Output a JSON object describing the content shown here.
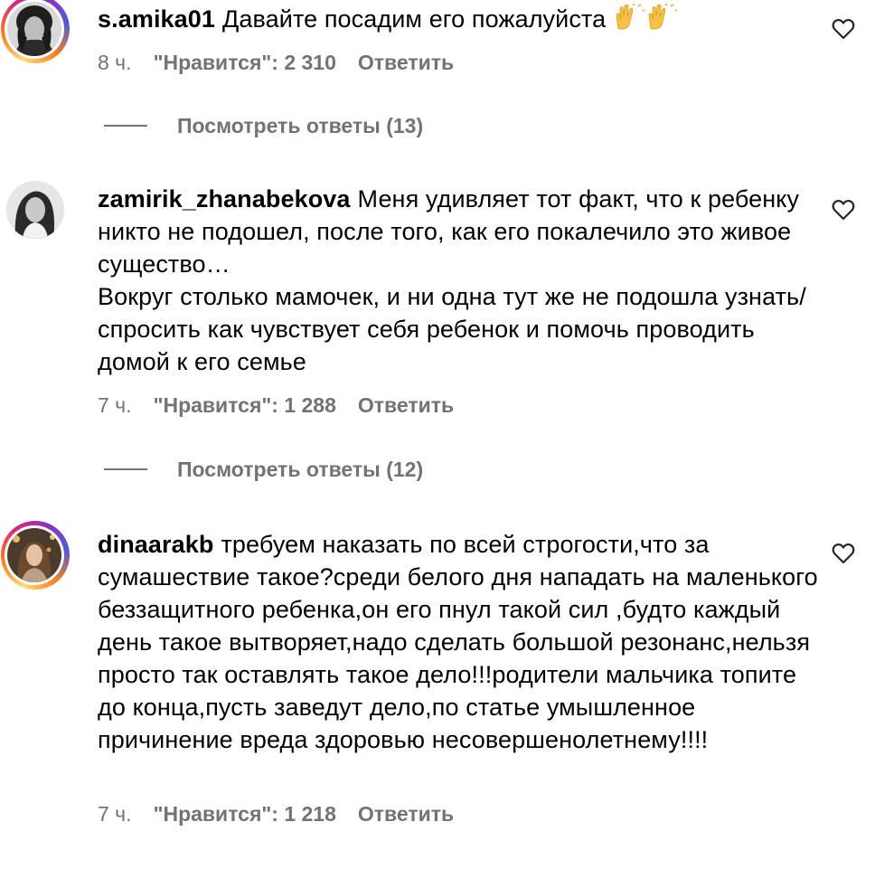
{
  "comments": [
    {
      "username": "s.amika01",
      "text": "Давайте посадим его пожалуйста",
      "emoji": "🙌🙌",
      "time": "8 ч.",
      "likes": "\"Нравится\": 2 310",
      "reply_label": "Ответить",
      "view_replies": "Посмотреть ответы (13)",
      "has_story_ring": true,
      "avatar_icon": "woman-portrait-bw"
    },
    {
      "username": "zamirik_zhanabekova",
      "text": "Меня удивляет тот факт, что к ребенку никто не подошел, после того, как его покалечило это живое существо…\nВокруг столько мамочек, и ни одна тут же не подошла узнать/спросить как чувствует себя ребенок и помочь проводить домой к его семье",
      "time": "7 ч.",
      "likes": "\"Нравится\": 1 288",
      "reply_label": "Ответить",
      "view_replies": "Посмотреть ответы (12)",
      "has_story_ring": false,
      "avatar_icon": "woman-portrait-bw"
    },
    {
      "username": "dinaarakb",
      "text": "требуем наказать по всей строгости,что за сумашествие такое?среди белого дня нападать на маленького беззащитного ребенка,он его пнул такой сил ,будто каждый день такое вытворяет,надо сделать большой резонанс,нельзя просто так оставлять такое дело!!!родители мальчика топите до конца,пусть заведут дело,по статье умышленное причинение вреда здоровью несовершенолетнему!!!!",
      "time": "7 ч.",
      "likes": "\"Нравится\": 1 218",
      "reply_label": "Ответить",
      "has_story_ring": true,
      "avatar_icon": "woman-portrait-color"
    }
  ],
  "colors": {
    "text": "#000000",
    "secondary": "#737373",
    "background": "#ffffff"
  },
  "icons": [
    "heart-outline-icon",
    "raising-hands-emoji"
  ]
}
